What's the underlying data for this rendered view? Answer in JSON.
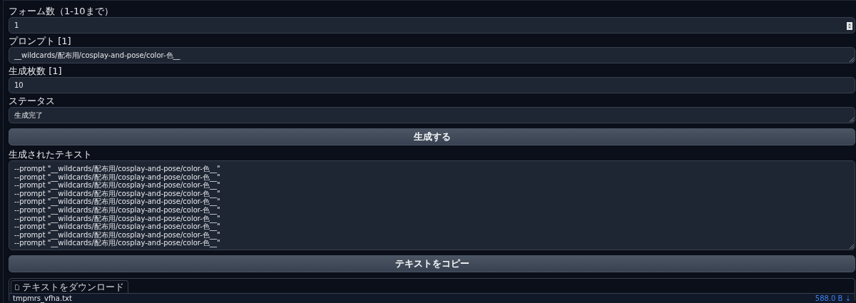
{
  "fields": [
    {
      "kind": "number",
      "label": "フォーム数（1-10まで）",
      "value": "1"
    },
    {
      "kind": "textarea",
      "label": "プロンプト [1]",
      "value": "__wildcards/配布用/cosplay-and-pose/color-色__"
    },
    {
      "kind": "text",
      "label": "生成枚数 [1]",
      "value": "10"
    },
    {
      "kind": "textarea",
      "label": "ステータス",
      "value": "生成完了"
    }
  ],
  "generate_button": "生成する",
  "output": {
    "label": "生成されたテキスト",
    "lines": [
      "--prompt \"__wildcards/配布用/cosplay-and-pose/color-色__\"",
      "--prompt \"__wildcards/配布用/cosplay-and-pose/color-色__\"",
      "--prompt \"__wildcards/配布用/cosplay-and-pose/color-色__\"",
      "--prompt \"__wildcards/配布用/cosplay-and-pose/color-色__\"",
      "--prompt \"__wildcards/配布用/cosplay-and-pose/color-色__\"",
      "--prompt \"__wildcards/配布用/cosplay-and-pose/color-色__\"",
      "--prompt \"__wildcards/配布用/cosplay-and-pose/color-色__\"",
      "--prompt \"__wildcards/配布用/cosplay-and-pose/color-色__\"",
      "--prompt \"__wildcards/配布用/cosplay-and-pose/color-色__\"",
      "--prompt \"__wildcards/配布用/cosplay-and-pose/color-色__\""
    ]
  },
  "copy_button": "テキストをコピー",
  "download": {
    "label": "テキストをダウンロード",
    "filename": "tmpmrs_vfha.txt",
    "size": "588.0 B",
    "link_icon": "⇣"
  }
}
